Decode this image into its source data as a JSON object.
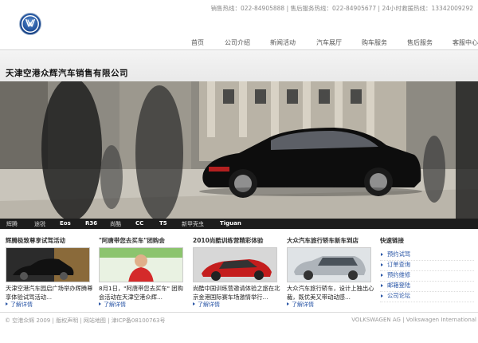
{
  "header": {
    "hotline": "销售热线：022-84905888 | 售后服务热线：022-84905677 | 24小时救援热线：13342009292"
  },
  "nav": [
    "首页",
    "公司介绍",
    "新闻活动",
    "汽车展厅",
    "购车服务",
    "售后服务",
    "客服中心"
  ],
  "company_name": "天津空港众辉汽车销售有限公司",
  "model_strip": [
    "辉腾",
    "途锐",
    "Eos",
    "R36",
    "尚酷",
    "CC",
    "T5",
    "新甲壳虫",
    "Tiguan"
  ],
  "news": [
    {
      "title": "辉腾极致尊享试驾活动",
      "text": "天津空港汽车园启广场举办辉腾尊享体验试驾活动...",
      "more": "了解详情"
    },
    {
      "title": "\"阿唐带您去买车\"团购会",
      "text": "8月1日，\"阿唐带您去买车\" 团购会活动在天津空港众辉...",
      "more": "了解详情"
    },
    {
      "title": "2010尚酷训练营精彩体验",
      "text": "尚酷中国训练营邀请体验之旅在北京金港国际赛车场激情举行...",
      "more": "了解详情"
    },
    {
      "title": "大众汽车旅行轿车新车到店",
      "text": "大众汽车旅行轿车，设计上独出心裁，既优美又带动动感...",
      "more": "了解详情"
    }
  ],
  "quick_links": {
    "title": "快速链接",
    "items": [
      "预约试驾",
      "订单查询",
      "预约维修",
      "邮箱登陆",
      "公司论坛"
    ]
  },
  "footer": {
    "left": "© 空港众辉 2009 | 版权声明 | 网站地图 | 津ICP备08100763号",
    "right": "VOLKSWAGEN AG | Volkswagen International"
  },
  "colors": {
    "link": "#2a56a6",
    "strip": "#1d1d1d",
    "vw_blue": "#1f4f9a"
  }
}
